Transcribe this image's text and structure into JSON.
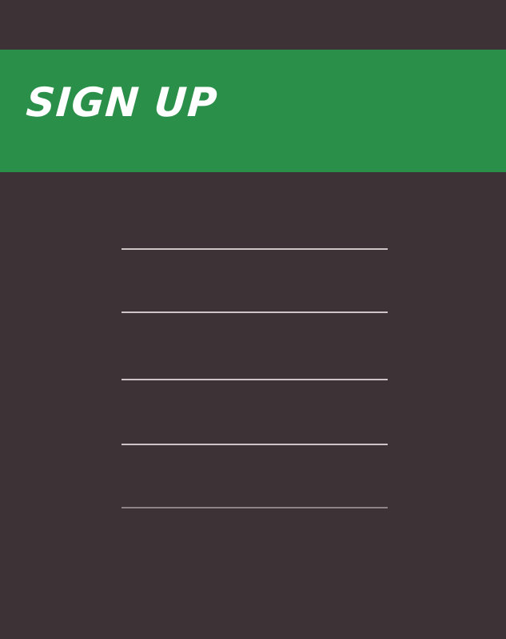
{
  "header": {
    "title": "SIGN UP",
    "background_color": "#2a8f48"
  },
  "theme": {
    "background_color": "#3d3235",
    "field_underline_color": "#cdc5c6"
  },
  "form": {
    "fields": [
      {
        "value": "",
        "placeholder": ""
      },
      {
        "value": "",
        "placeholder": ""
      },
      {
        "value": "",
        "placeholder": ""
      },
      {
        "value": "",
        "placeholder": ""
      },
      {
        "value": "",
        "placeholder": ""
      }
    ]
  }
}
